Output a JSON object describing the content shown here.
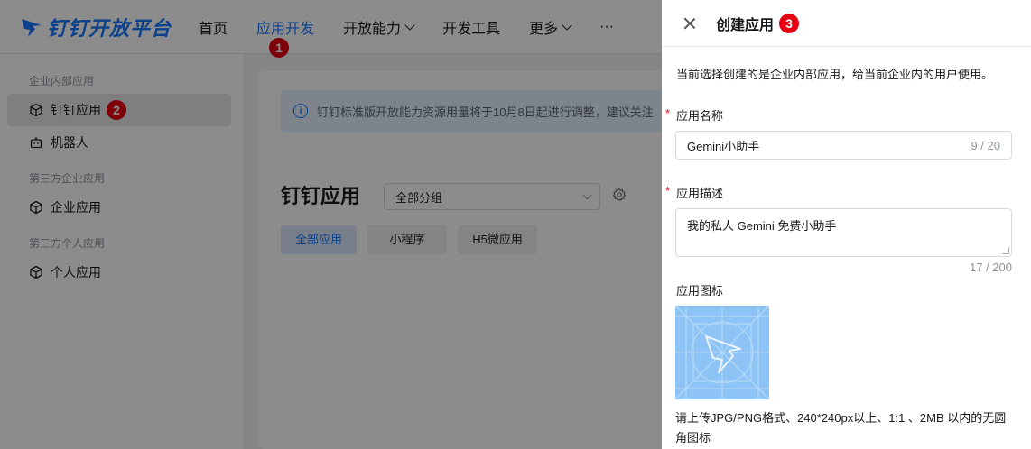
{
  "header": {
    "logo_text": "钉钉开放平台",
    "nav": [
      {
        "label": "首页"
      },
      {
        "label": "应用开发",
        "badge": "1"
      },
      {
        "label": "开放能力"
      },
      {
        "label": "开发工具"
      },
      {
        "label": "更多"
      },
      {
        "label": "···"
      }
    ]
  },
  "sidebar": {
    "group1": "企业内部应用",
    "item_dingtalk": "钉钉应用",
    "item_dingtalk_badge": "2",
    "item_robot": "机器人",
    "group2": "第三方企业应用",
    "item_enterprise": "企业应用",
    "group3": "第三方个人应用",
    "item_personal": "个人应用"
  },
  "main": {
    "notice": "钉钉标准版开放能力资源用量将于10月8日起进行调整，建议关注",
    "title": "钉钉应用",
    "group_select": "全部分组",
    "tabs": [
      "全部应用",
      "小程序",
      "H5微应用"
    ]
  },
  "drawer": {
    "title": "创建应用",
    "badge": "3",
    "desc": "当前选择创建的是企业内部应用，给当前企业内的用户使用。",
    "name_label": "应用名称",
    "name_value": "Gemini小助手",
    "name_count": "9 / 20",
    "desc_label": "应用描述",
    "desc_value": "我的私人 Gemini 免费小助手",
    "desc_count": "17 / 200",
    "icon_label": "应用图标",
    "upload_hint": "请上传JPG/PNG格式、240*240px以上、1:1 、2MB 以内的无圆角图标"
  },
  "colors": {
    "brand": "#1677ff",
    "badge": "#e60012",
    "icon_bg": "#8dc4f5"
  }
}
